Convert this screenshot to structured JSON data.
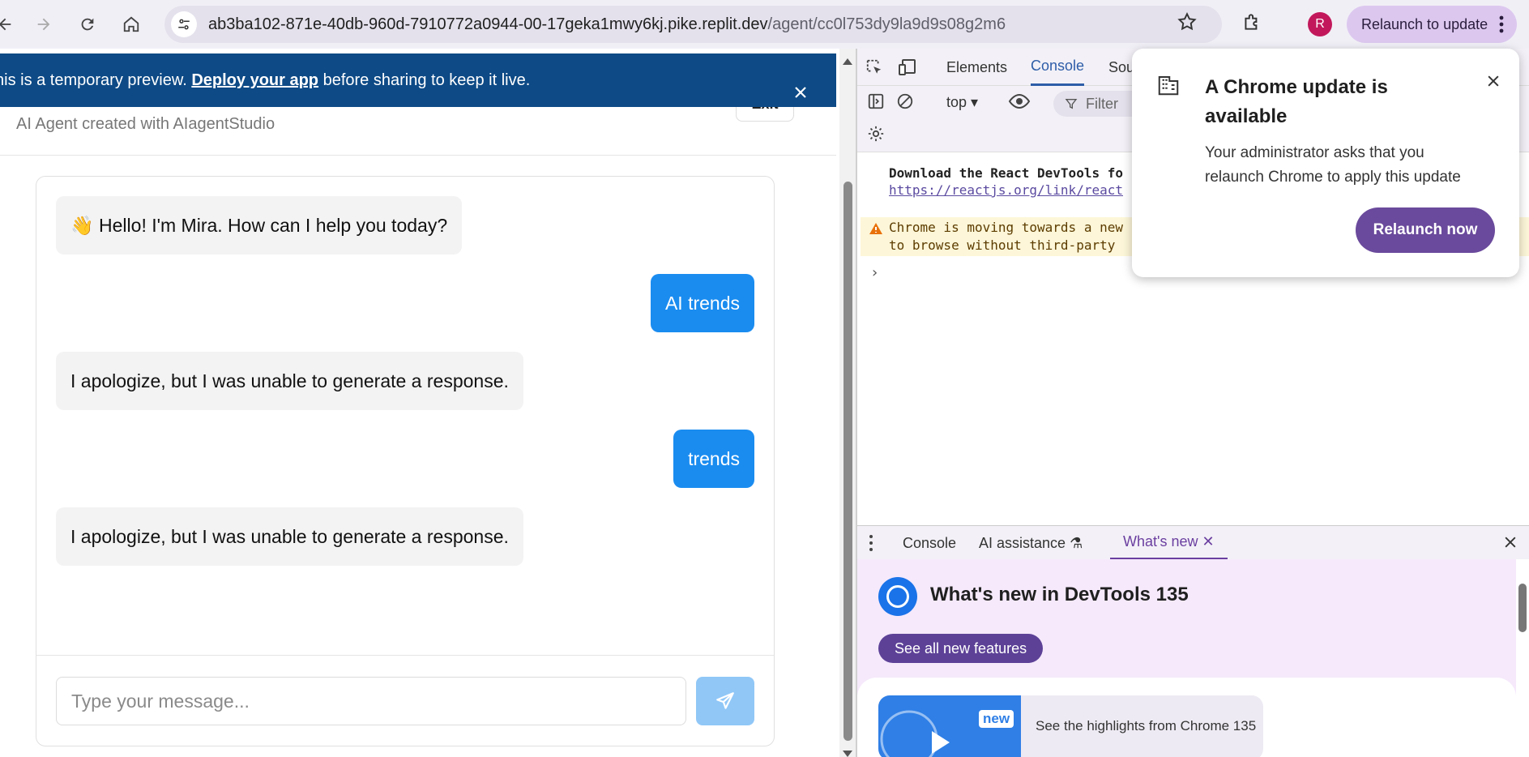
{
  "browser": {
    "url_main": "ab3ba102-871e-40db-960d-7910772a0944-00-17geka1mwy6kj.pike.replit.dev",
    "url_path": "/agent/cc0l753dy9la9d9s08g2m6",
    "avatar_letter": "R",
    "relaunch_label": "Relaunch to update"
  },
  "banner": {
    "prefix": "his is a temporary preview.",
    "link": "Deploy your app",
    "suffix": "before sharing to keep it live."
  },
  "page": {
    "exit_label": "Exit",
    "subtitle": "AI Agent created with AIagentStudio"
  },
  "chat": {
    "messages": [
      {
        "role": "bot",
        "text": "👋 Hello! I'm Mira. How can I help you today?"
      },
      {
        "role": "user",
        "text": "AI trends"
      },
      {
        "role": "bot",
        "text": "I apologize, but I was unable to generate a response."
      },
      {
        "role": "user",
        "text": "trends"
      },
      {
        "role": "bot",
        "text": "I apologize, but I was unable to generate a response."
      }
    ],
    "input_placeholder": "Type your message..."
  },
  "devtools": {
    "tabs": [
      "Elements",
      "Console",
      "Sou"
    ],
    "context": "top",
    "filter_placeholder": "Filter",
    "log_line": "Download the React DevTools fo",
    "log_link": "https://reactjs.org/link/react",
    "warn_line1": "Chrome is moving towards a new",
    "warn_line2": "to browse without third-party",
    "drawer_tabs": [
      "Console",
      "AI assistance",
      "What's new"
    ],
    "whatsnew_title": "What's new in DevTools 135",
    "whatsnew_button": "See all new features",
    "whatsnew_badge": "new",
    "whatsnew_caption": "See the highlights from Chrome 135"
  },
  "update_popup": {
    "title": "A Chrome update is available",
    "body": "Your administrator asks that you relaunch Chrome to apply this update",
    "button": "Relaunch now"
  },
  "colors": {
    "banner": "#0d4a86",
    "user_bubble": "#1a8cf0",
    "relaunch_button": "#6a4a9c"
  }
}
